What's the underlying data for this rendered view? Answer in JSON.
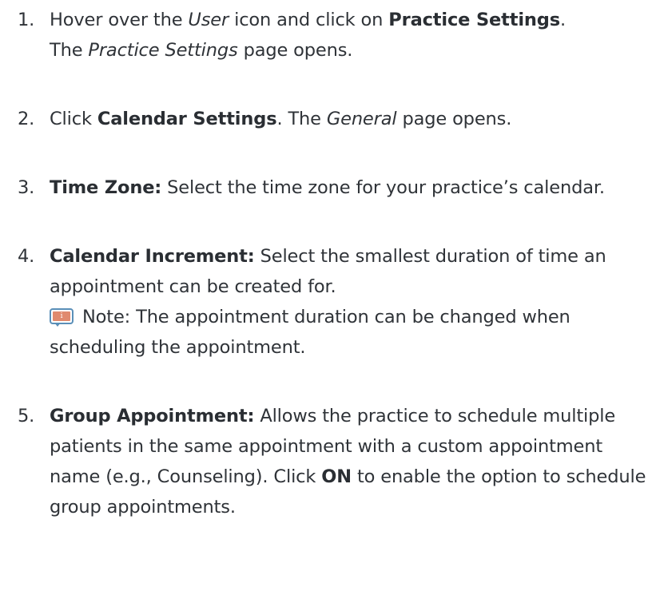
{
  "steps": [
    {
      "number": "1.",
      "l1_a": "Hover over the ",
      "l1_b": "User",
      "l1_c": " icon and click on ",
      "l1_d": "Practice Settings",
      "l1_e": ".",
      "l2_a": "The ",
      "l2_b": "Practice Settings",
      "l2_c": " page opens."
    },
    {
      "number": "2.",
      "a": "Click ",
      "b": "Calendar Settings",
      "c": ". The ",
      "d": "General",
      "e": " page opens."
    },
    {
      "number": "3.",
      "label": "Time Zone:",
      "text": " Select the time zone for your practice’s calendar."
    },
    {
      "number": "4.",
      "label": "Calendar Increment:",
      "text": " Select the smallest duration of time an appointment can be created for.",
      "note_icon_glyph": "i",
      "note_text": " Note: The appointment duration can be changed when scheduling the appointment."
    },
    {
      "number": "5.",
      "label": "Group Appointment:",
      "text_a": " Allows the practice to schedule multiple patients in the same appointment with a custom appointment name (e.g., Counseling). Click ",
      "on": "ON",
      "text_b": " to enable the option to schedule group appointments."
    }
  ],
  "colors": {
    "text": "#2f3338",
    "note_icon_border": "#5a8fb8",
    "note_icon_fill": "#e08a6e"
  }
}
